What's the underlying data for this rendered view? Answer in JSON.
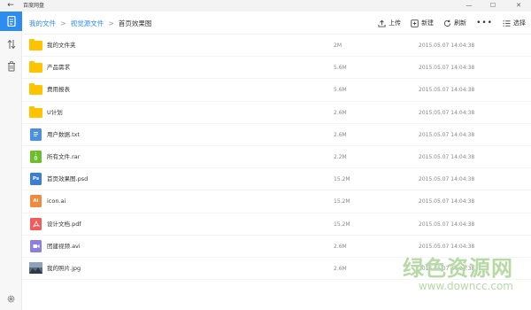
{
  "window": {
    "title": "百度网盘",
    "back_glyph": "←",
    "minimize_glyph": "—",
    "maximize_glyph": "☐",
    "close_glyph": "✕"
  },
  "breadcrumb": [
    {
      "label": "我的文件"
    },
    {
      "label": "视觉源文件"
    },
    {
      "label": "首页效果图"
    }
  ],
  "breadcrumb_separator": ">",
  "toolbar": {
    "upload": "上传",
    "new": "新建",
    "refresh": "刷新",
    "more": "•••",
    "select": "选择"
  },
  "files": [
    {
      "name": "我的文件夹",
      "size": "2M",
      "date": "2015.05.07  14:04:38",
      "kind": "folder"
    },
    {
      "name": "产品需求",
      "size": "5.6M",
      "date": "2015.05.07  14:04:38",
      "kind": "folder"
    },
    {
      "name": "费用报表",
      "size": "5.6M",
      "date": "2015.05.07  14:04:38",
      "kind": "folder"
    },
    {
      "name": "U计划",
      "size": "2.6M",
      "date": "2015.05.07  14:04:38",
      "kind": "folder"
    },
    {
      "name": "用户数据.txt",
      "size": "2.6M",
      "date": "2015.05.07  14:04:38",
      "kind": "txt"
    },
    {
      "name": "所有文件.rar",
      "size": "2.2M",
      "date": "2015.05.07  14:04:38",
      "kind": "rar"
    },
    {
      "name": "首页效果图.psd",
      "size": "15.2M",
      "date": "2015.05.07  14:04:38",
      "kind": "psd",
      "badge": "Ps"
    },
    {
      "name": "icon.ai",
      "size": "15.2M",
      "date": "2015.05.07  14:04:38",
      "kind": "ai",
      "badge": "Ai"
    },
    {
      "name": "设计文档.pdf",
      "size": "15.2M",
      "date": "2015.05.07  14:04:38",
      "kind": "pdf"
    },
    {
      "name": "团建视频.avi",
      "size": "2.6M",
      "date": "2015.05.07  14:04:38",
      "kind": "avi"
    },
    {
      "name": "我的照片.jpg",
      "size": "2.6M",
      "date": "2015.05.07  14:04:38",
      "kind": "jpg"
    }
  ],
  "colors": {
    "accent": "#2d8cf0",
    "folder": "#ffc300",
    "txt": "#4a90e2",
    "rar": "#6cbf2a",
    "psd": "#3a7fd5",
    "ai": "#f08a3c",
    "pdf": "#f05b5b",
    "avi": "#8b7fe0"
  },
  "watermark": {
    "line1": "绿色资源网",
    "line2": "www.downcc.com"
  }
}
